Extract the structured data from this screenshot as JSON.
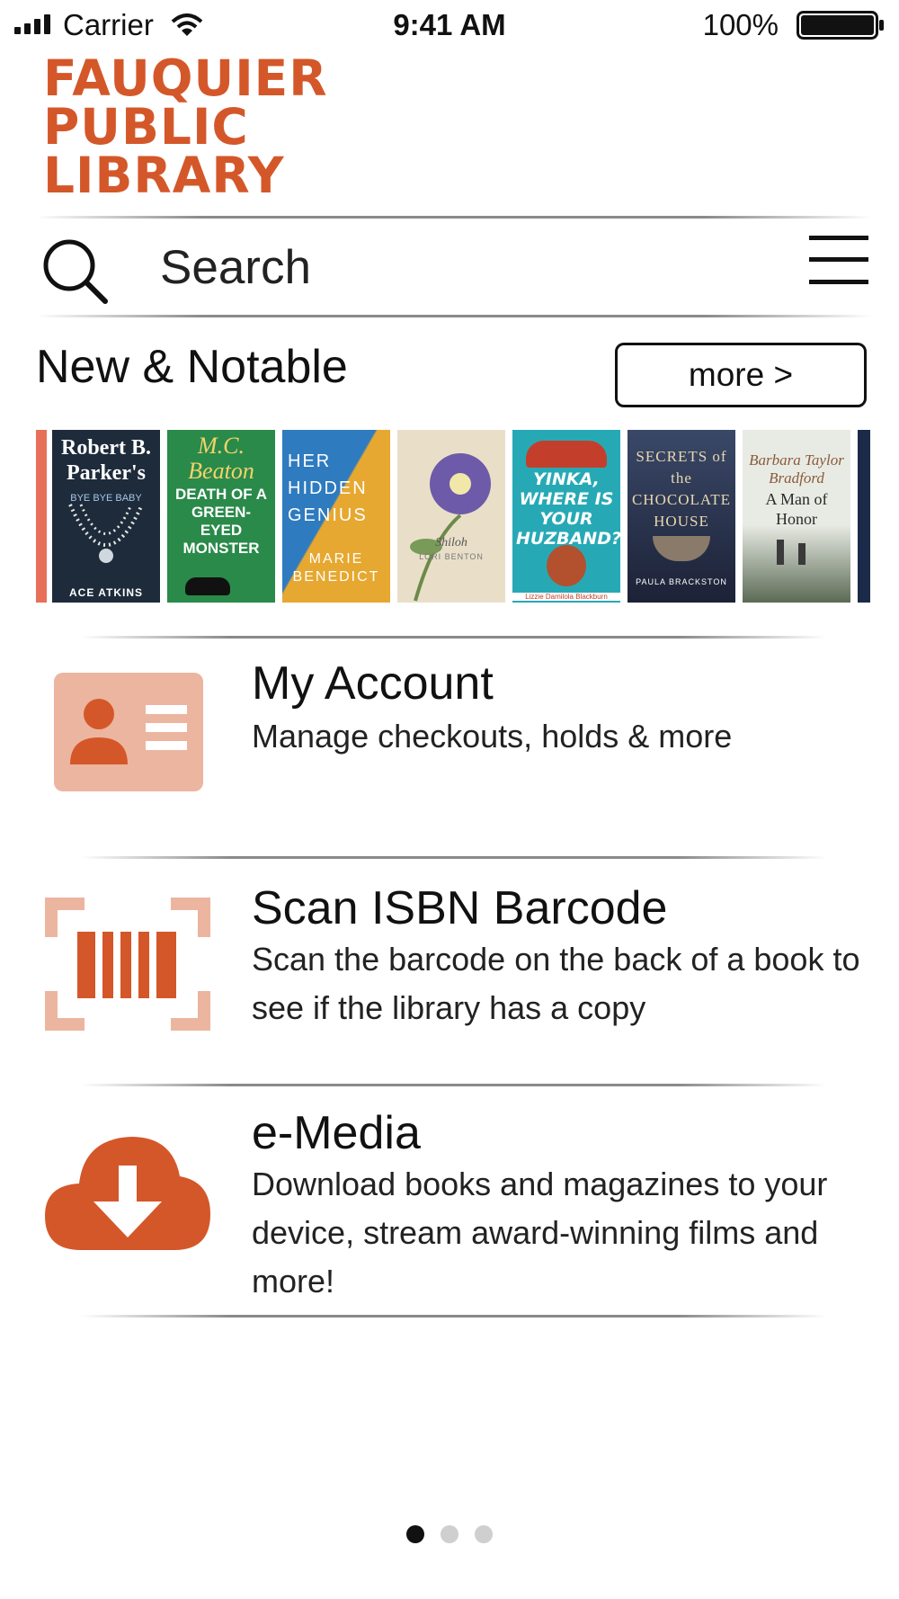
{
  "status_bar": {
    "carrier": "Carrier",
    "time": "9:41 AM",
    "battery": "100%",
    "battery_level": 1.0
  },
  "logo": {
    "lines": [
      "FAUQUIER",
      "PUBLIC",
      "LIBRARY"
    ],
    "color": "#d4572a"
  },
  "search": {
    "placeholder": "Search"
  },
  "new_notable": {
    "title": "New & Notable",
    "more_label": "more >",
    "books": [
      {
        "title": "Robert B. Parker's",
        "subtitle": "BYE BYE BABY",
        "author": "ACE ATKINS",
        "color": "#1d2b3a"
      },
      {
        "title": "M.C. Beaton",
        "subtitle": "DEATH OF A GREEN-EYED MONSTER",
        "author": "",
        "color": "#2a8a4a"
      },
      {
        "title": "HER HIDDEN GENIUS",
        "subtitle": "",
        "author": "MARIE BENEDICT",
        "color": "#2f7bbf"
      },
      {
        "title": "Shiloh",
        "subtitle": "",
        "author": "LORI BENTON",
        "color": "#e9dfc9"
      },
      {
        "title": "YINKA, WHERE IS YOUR HUZBAND?",
        "subtitle": "",
        "author": "Lizzie Damilola Blackburn",
        "color": "#27a9b5"
      },
      {
        "title": "SECRETS of the CHOCOLATE HOUSE",
        "subtitle": "",
        "author": "PAULA BRACKSTON",
        "color": "#2b3550"
      },
      {
        "title": "Barbara Taylor Bradford",
        "subtitle": "A Man of Honor",
        "author": "",
        "color": "#dfe2da"
      }
    ]
  },
  "menu_items": [
    {
      "title": "My Account",
      "description": "Manage checkouts, holds & more",
      "icon": "id-card-icon"
    },
    {
      "title": "Scan ISBN Barcode",
      "description": "Scan the barcode on the back of a book to see if the library has a copy",
      "icon": "barcode-scan-icon"
    },
    {
      "title": "e-Media",
      "description": "Download books and magazines to your device, stream award-winning films and more!",
      "icon": "cloud-download-icon"
    }
  ],
  "pagination": {
    "pages": 3,
    "current": 1
  },
  "colors": {
    "accent": "#d4572a",
    "accent_light": "#ecb5a0"
  }
}
